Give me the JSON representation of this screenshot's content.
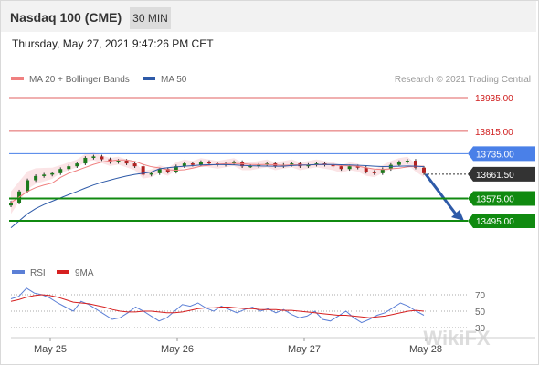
{
  "header": {
    "symbol": "Nasdaq 100 (CME)",
    "timeframe": "30 MIN",
    "datetime": "Thursday, May 27, 2021 9:47:26 PM CET"
  },
  "legend": {
    "ma20": "MA 20 + Bollinger Bands",
    "ma50": "MA 50",
    "ma20_color": "#f08080",
    "ma50_color": "#2e5aa8",
    "copyright": "Research © 2021 Trading Central"
  },
  "rsi_legend": {
    "rsi": "RSI",
    "ma": "9MA",
    "rsi_color": "#5b7fd6",
    "ma_color": "#d62020"
  },
  "watermark": "WikiFX",
  "chart_data": [
    {
      "type": "candlestick",
      "x_ticks": [
        "May 25",
        "May 26",
        "May 27",
        "May 28"
      ],
      "levels": [
        {
          "value": 13935.0,
          "label": "13935.00",
          "role": "resistance 2",
          "color": "#e06060"
        },
        {
          "value": 13815.0,
          "label": "13815.00",
          "role": "resistance 1",
          "color": "#e06060"
        },
        {
          "value": 13735.0,
          "label": "13735.00",
          "role": "pivot",
          "color": "#4a80e8"
        },
        {
          "value": 13661.5,
          "label": "13661.50",
          "role": "last price",
          "color": "#333333"
        },
        {
          "value": 13575.0,
          "label": "13575.00",
          "role": "support 1",
          "color": "#108a10"
        },
        {
          "value": 13495.0,
          "label": "13495.00",
          "role": "support 2",
          "color": "#108a10"
        }
      ],
      "close_series": [
        13560,
        13600,
        13640,
        13655,
        13660,
        13665,
        13680,
        13690,
        13700,
        13720,
        13725,
        13715,
        13705,
        13710,
        13700,
        13690,
        13660,
        13665,
        13680,
        13670,
        13690,
        13700,
        13695,
        13705,
        13700,
        13695,
        13700,
        13705,
        13690,
        13690,
        13695,
        13700,
        13690,
        13695,
        13700,
        13690,
        13695,
        13700,
        13695,
        13690,
        13680,
        13690,
        13685,
        13670,
        13665,
        13680,
        13695,
        13705,
        13710,
        13685,
        13665
      ],
      "forecast": {
        "from": 13661.5,
        "to": 13495.0
      }
    },
    {
      "type": "line",
      "name": "RSI",
      "levels": [
        70,
        50,
        30
      ],
      "ylim": [
        20,
        80
      ],
      "series": [
        {
          "name": "RSI",
          "values": [
            65,
            68,
            78,
            72,
            70,
            66,
            60,
            55,
            50,
            62,
            58,
            52,
            46,
            40,
            42,
            48,
            55,
            50,
            44,
            38,
            42,
            50,
            58,
            56,
            60,
            54,
            50,
            56,
            52,
            48,
            52,
            55,
            50,
            53,
            48,
            52,
            46,
            42,
            44,
            50,
            40,
            38,
            44,
            50,
            42,
            36,
            40,
            45,
            48,
            54,
            60,
            56,
            50,
            45
          ]
        },
        {
          "name": "9MA",
          "values": [
            62,
            64,
            67,
            69,
            70,
            69,
            67,
            64,
            61,
            60,
            59,
            57,
            55,
            52,
            50,
            49,
            49,
            50,
            50,
            49,
            48,
            48,
            49,
            51,
            53,
            54,
            54,
            55,
            55,
            54,
            53,
            53,
            52,
            52,
            52,
            51,
            51,
            50,
            49,
            48,
            47,
            46,
            45,
            45,
            44,
            43,
            42,
            43,
            44,
            46,
            48,
            50,
            51,
            50
          ]
        }
      ]
    }
  ]
}
